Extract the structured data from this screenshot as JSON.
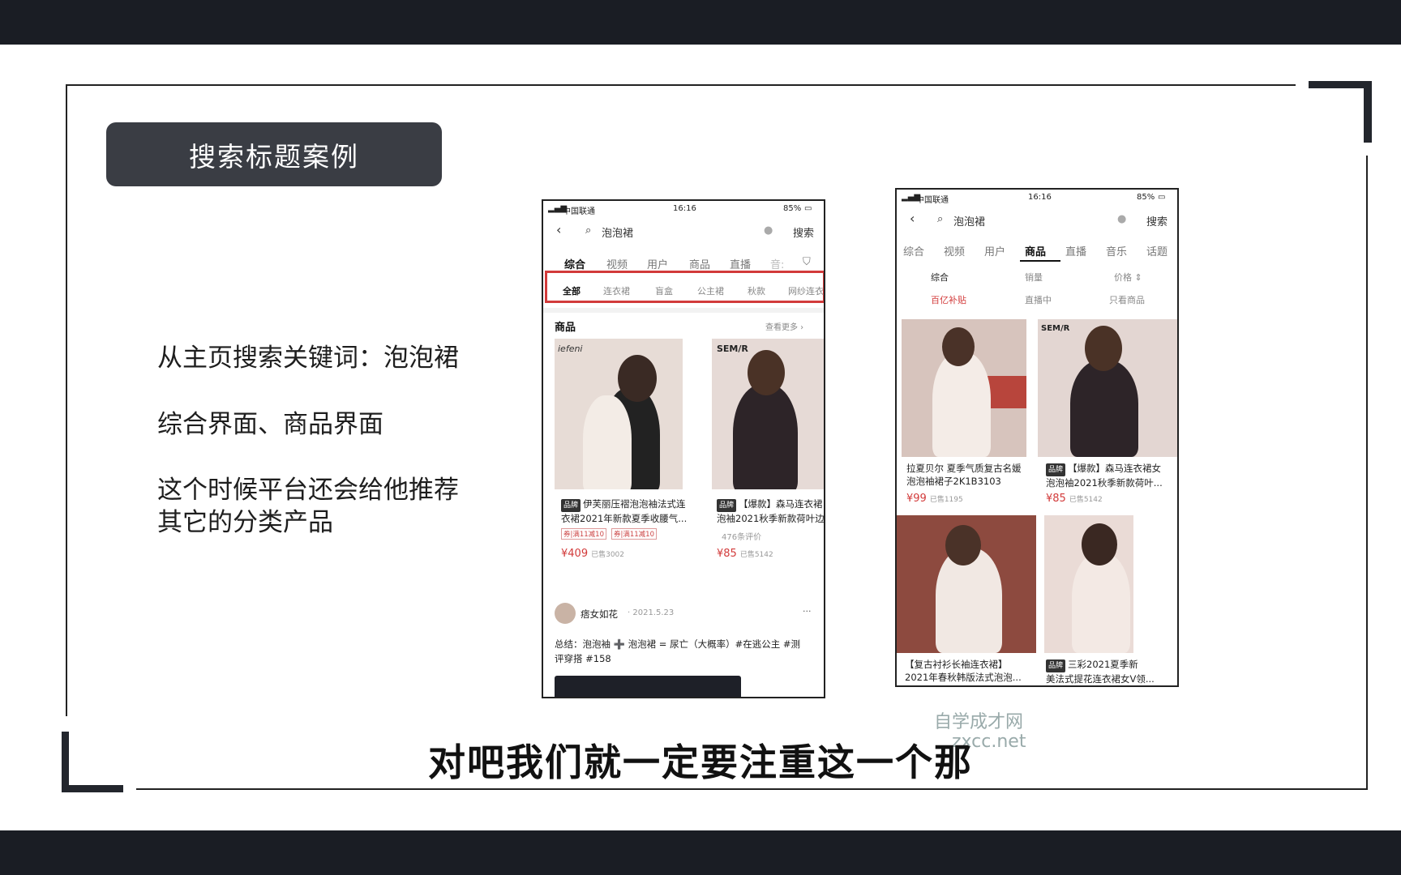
{
  "slide": {
    "title": "搜索标题案例",
    "points": [
      "从主页搜索关键词：泡泡裙",
      "综合界面、商品界面",
      "这个时候平台还会给他推荐其它的分类产品"
    ]
  },
  "phone1": {
    "status": {
      "carrier": "中国联通",
      "time": "16:16",
      "battery": "85%"
    },
    "search": {
      "query": "泡泡裙",
      "button": "搜索"
    },
    "tabs": [
      "综合",
      "视频",
      "用户",
      "商品",
      "直播",
      "音:"
    ],
    "categories": [
      "全部",
      "连衣裙",
      "盲盒",
      "公主裙",
      "秋款",
      "网纱连衣"
    ],
    "section_title": "商品",
    "see_more": "查看更多 ›",
    "products": [
      {
        "brand_text": "iefeni",
        "badge": "品牌",
        "title_line1": "伊芙丽压褶泡泡袖法式连",
        "title_line2": "衣裙2021年新款夏季收腰气...",
        "coupons": [
          "券|满11减10",
          "券|满11减10"
        ],
        "price": "¥409",
        "sold": "已售3002"
      },
      {
        "brand_text": "SEM/R",
        "badge": "品牌",
        "title_line1": "【爆款】森马连衣裙",
        "title_line2": "泡袖2021秋季新款荷叶边",
        "reviews": "476条评价",
        "price": "¥85",
        "sold": "已售5142"
      }
    ],
    "post": {
      "author": "痞女如花",
      "date": "· 2021.5.23",
      "more": "···",
      "text_line1": "总结：泡泡袖 ➕ 泡泡裙 = 尿亡（大概率）#在逃公主 #测",
      "text_line2": "评穿搭 #158"
    }
  },
  "phone2": {
    "status": {
      "carrier": "中国联通",
      "time": "16:16",
      "battery": "85%"
    },
    "search": {
      "query": "泡泡裙",
      "button": "搜索"
    },
    "tabs": [
      "综合",
      "视频",
      "用户",
      "商品",
      "直播",
      "音乐",
      "话题"
    ],
    "sort": [
      "综合",
      "销量",
      "价格 ⇕"
    ],
    "filters": [
      "百亿补贴",
      "直播中",
      "只看商品"
    ],
    "products": [
      {
        "title_line1": "拉夏贝尔 夏季气质复古名媛",
        "title_line2": "泡泡袖裙子2K1B3103",
        "price": "¥99",
        "sold": "已售1195"
      },
      {
        "badge": "品牌",
        "title_line1": "【爆款】森马连衣裙女",
        "title_line2": "泡泡袖2021秋季新款荷叶...",
        "price": "¥85",
        "sold": "已售5142",
        "brand_text": "SEM/R"
      },
      {
        "title_line1": "【复古衬衫长袖连衣裙】",
        "title_line2": "2021年春秋韩版法式泡泡..."
      },
      {
        "badge": "品牌",
        "title_line1": "三彩2021夏季新",
        "title_line2": "美法式提花连衣裙女V领..."
      }
    ]
  },
  "subtitle": "对吧我们就一定要注重这一个那",
  "watermark": {
    "line1": "自学成才网",
    "line2": "zxcc.net"
  },
  "colors": {
    "accent_red": "#d23a3a",
    "title_bg": "#3a3d44"
  }
}
